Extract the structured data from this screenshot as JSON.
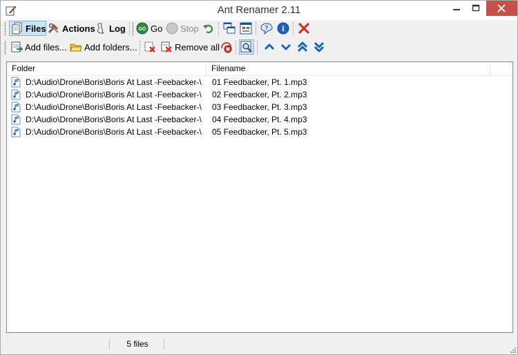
{
  "window": {
    "title": "Ant Renamer 2.11"
  },
  "toolbar_main": {
    "files_label": "Files",
    "actions_label": "Actions",
    "log_label": "Log",
    "go_label": "Go",
    "stop_label": "Stop"
  },
  "toolbar_files": {
    "add_files_label": "Add files...",
    "add_folders_label": "Add folders...",
    "remove_all_label": "Remove all"
  },
  "file_list": {
    "columns": [
      "Folder",
      "Filename"
    ],
    "rows": [
      {
        "folder": "D:\\Audio\\Drone\\Boris\\Boris At Last -Feebacker-\\",
        "filename": "01 Feedbacker, Pt. 1.mp3"
      },
      {
        "folder": "D:\\Audio\\Drone\\Boris\\Boris At Last -Feebacker-\\",
        "filename": "02 Feedbacker, Pt. 2.mp3"
      },
      {
        "folder": "D:\\Audio\\Drone\\Boris\\Boris At Last -Feebacker-\\",
        "filename": "03 Feedbacker, Pt. 3.mp3"
      },
      {
        "folder": "D:\\Audio\\Drone\\Boris\\Boris At Last -Feebacker-\\",
        "filename": "04 Feedbacker, Pt. 4.mp3"
      },
      {
        "folder": "D:\\Audio\\Drone\\Boris\\Boris At Last -Feebacker-\\",
        "filename": "05 Feedbacker, Pt. 5.mp3"
      }
    ]
  },
  "status": {
    "count_text": "5 files"
  },
  "colors": {
    "close_button": "#c7504b",
    "pressed_bg": "#cce4f7",
    "accent_blue": "#1565c0"
  }
}
